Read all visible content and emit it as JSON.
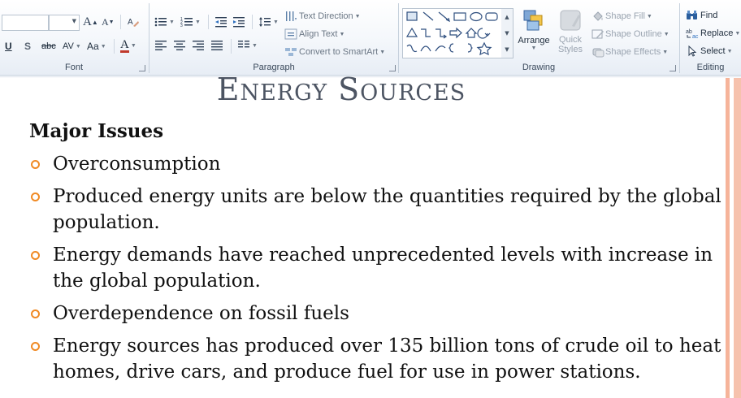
{
  "ribbon": {
    "font": {
      "label": "Font",
      "grow_font": "A",
      "shrink_font": "A",
      "underline": "U",
      "shadow": "S",
      "strikethrough": "abc",
      "char_spacing": "AV",
      "change_case": "Aa",
      "font_color": "A"
    },
    "paragraph": {
      "label": "Paragraph",
      "text_direction": "Text Direction",
      "align_text": "Align Text",
      "convert_smartart": "Convert to SmartArt"
    },
    "drawing": {
      "label": "Drawing",
      "arrange": "Arrange",
      "quick_styles": "Quick Styles",
      "shape_fill": "Shape Fill",
      "shape_outline": "Shape Outline",
      "shape_effects": "Shape Effects"
    },
    "editing": {
      "label": "Editing",
      "find": "Find",
      "replace": "Replace",
      "select": "Select"
    }
  },
  "slide": {
    "title": "Energy Sources",
    "heading": "Major Issues",
    "bullets": [
      "Overconsumption",
      "Produced energy units are below the quantities required by the global population.",
      "Energy demands have reached unprecedented levels with increase in the global population.",
      "Overdependence on fossil fuels",
      "Energy sources has produced over 135 billion tons of crude oil to heat homes, drive cars, and produce fuel for use in power stations."
    ]
  },
  "colors": {
    "bullet": "#f08a24",
    "accent_stripe": "#f6b49a",
    "title": "#4d5563"
  }
}
